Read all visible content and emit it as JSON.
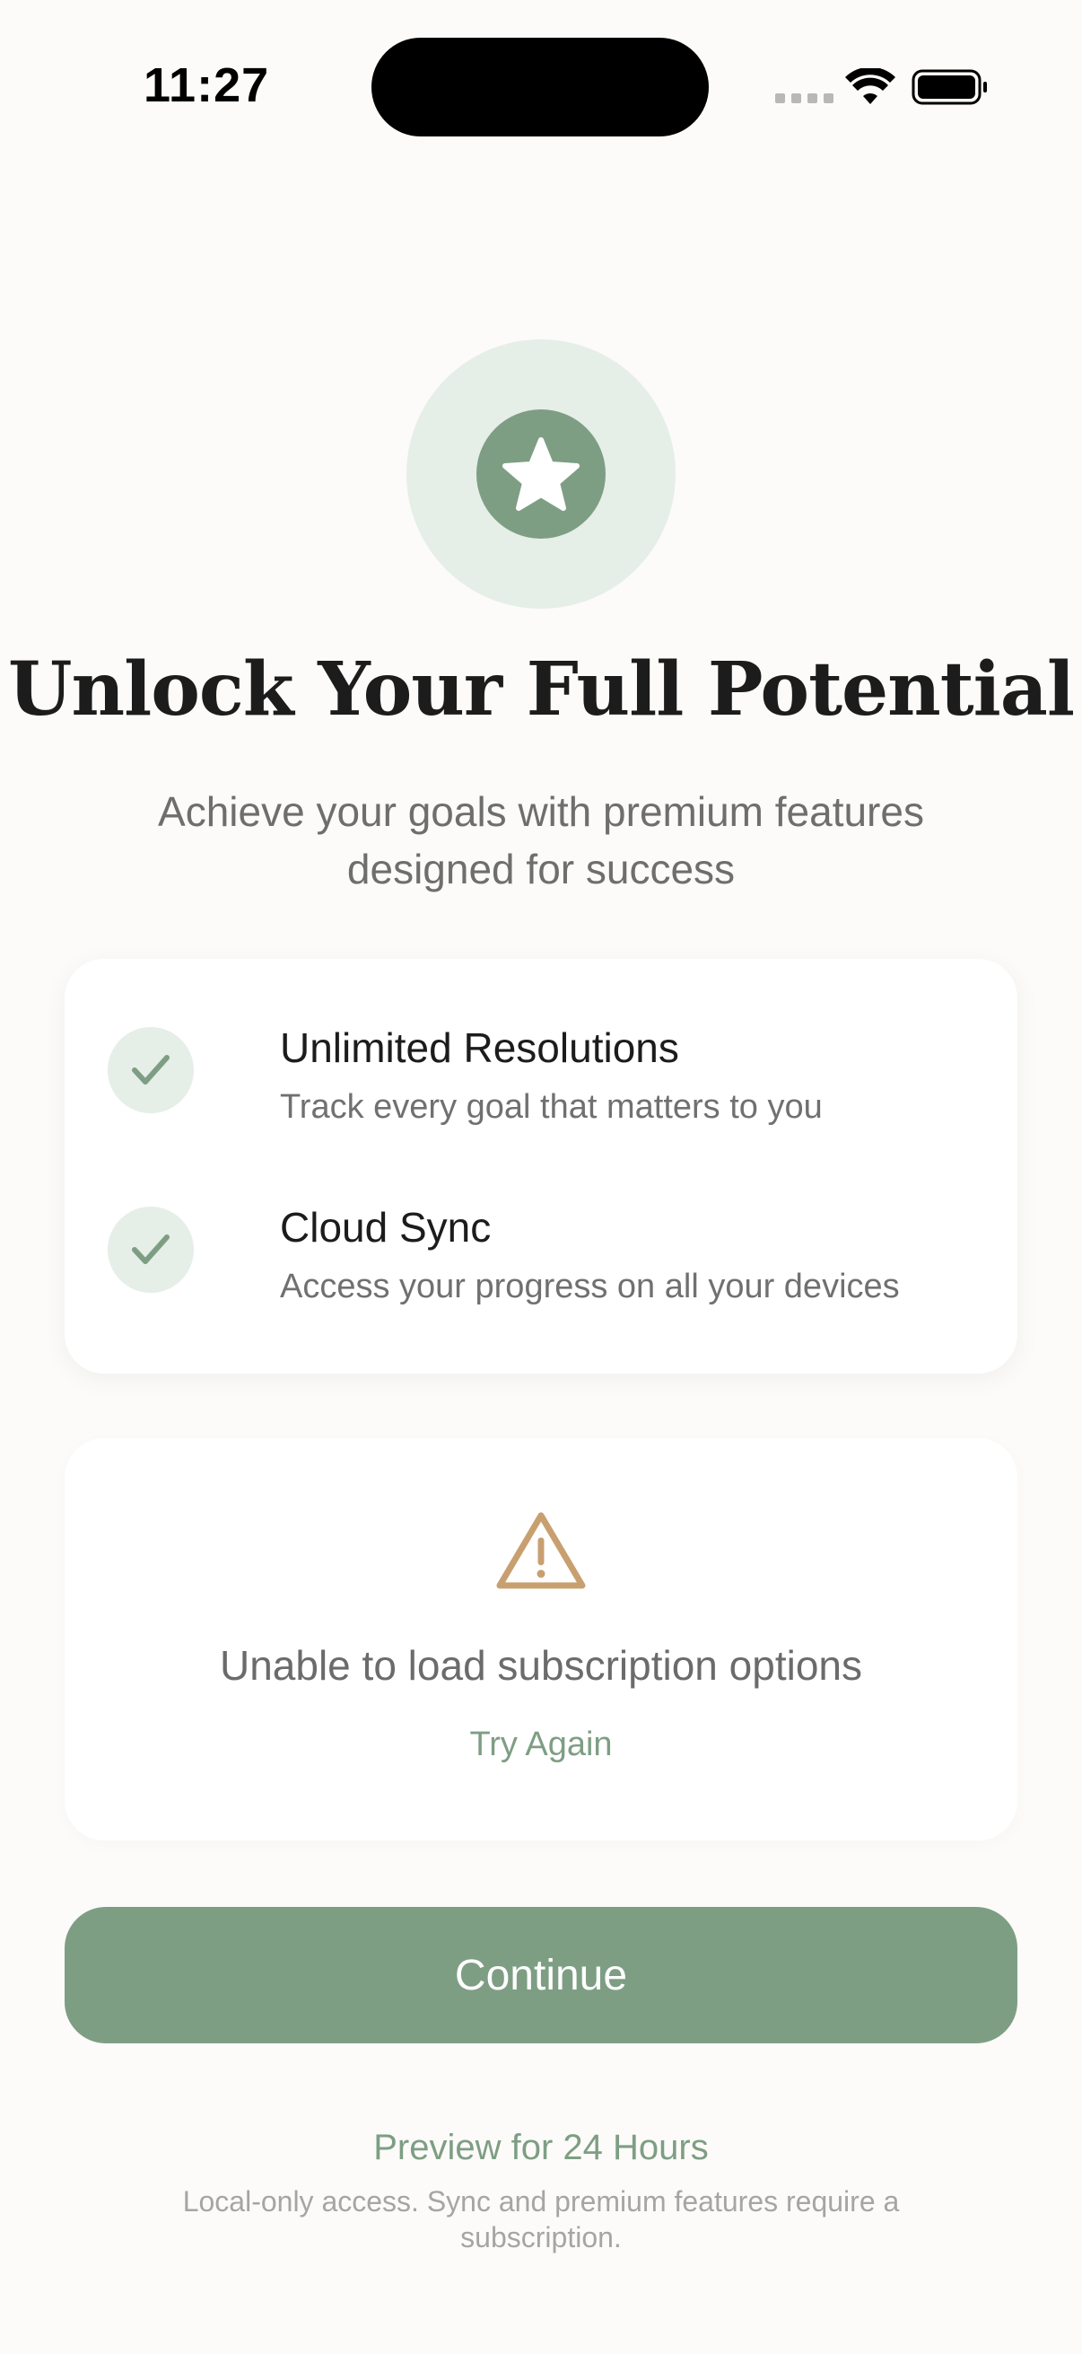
{
  "status_bar": {
    "time": "11:27"
  },
  "hero": {
    "icon": "star-icon",
    "title": "Unlock Your Full Potential",
    "subtitle": "Achieve your goals with premium features designed for success"
  },
  "features": [
    {
      "title": "Unlimited Resolutions",
      "description": "Track every goal that matters to you",
      "icon": "checkmark-icon"
    },
    {
      "title": "Cloud Sync",
      "description": "Access your progress on all your devices",
      "icon": "checkmark-icon"
    }
  ],
  "error": {
    "icon": "warning-icon",
    "message": "Unable to load subscription options",
    "retry_label": "Try Again"
  },
  "continue_label": "Continue",
  "preview": {
    "label": "Preview for 24 Hours",
    "note": "Local-only access. Sync and premium features require a subscription."
  },
  "colors": {
    "accent": "#7E9E84",
    "accent_light": "#E6EEE8",
    "warning": "#C8A070",
    "background": "#FCFBF9"
  }
}
